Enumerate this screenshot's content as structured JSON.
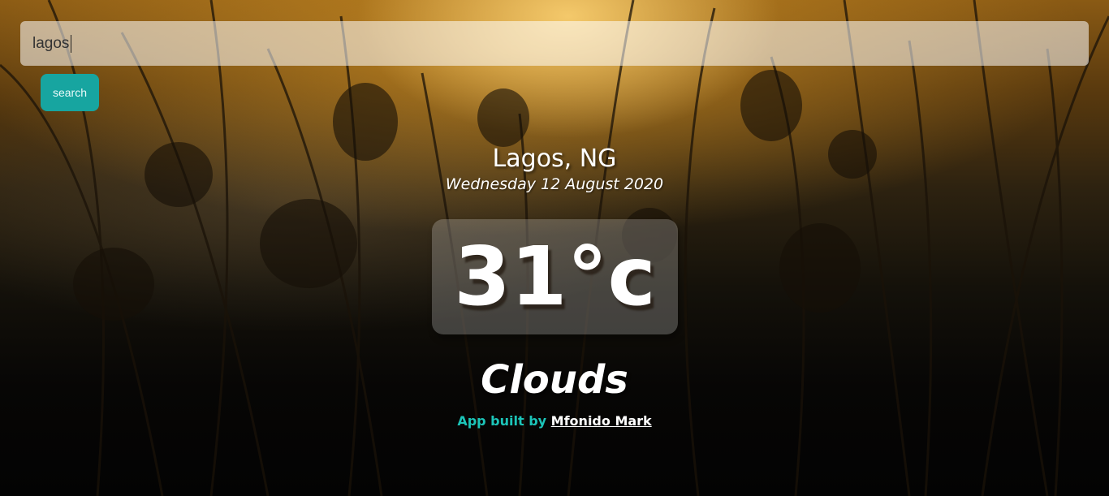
{
  "search": {
    "value": "lagos",
    "button_label": "search"
  },
  "weather": {
    "location": "Lagos, NG",
    "date": "Wednesday 12 August 2020",
    "temperature": "31°c",
    "condition": "Clouds"
  },
  "footer": {
    "credit_text": "App built by",
    "author": "Mfonido Mark"
  },
  "colors": {
    "accent": "#17a5a0",
    "credit": "#1cc4b8",
    "text": "#ffffff"
  }
}
